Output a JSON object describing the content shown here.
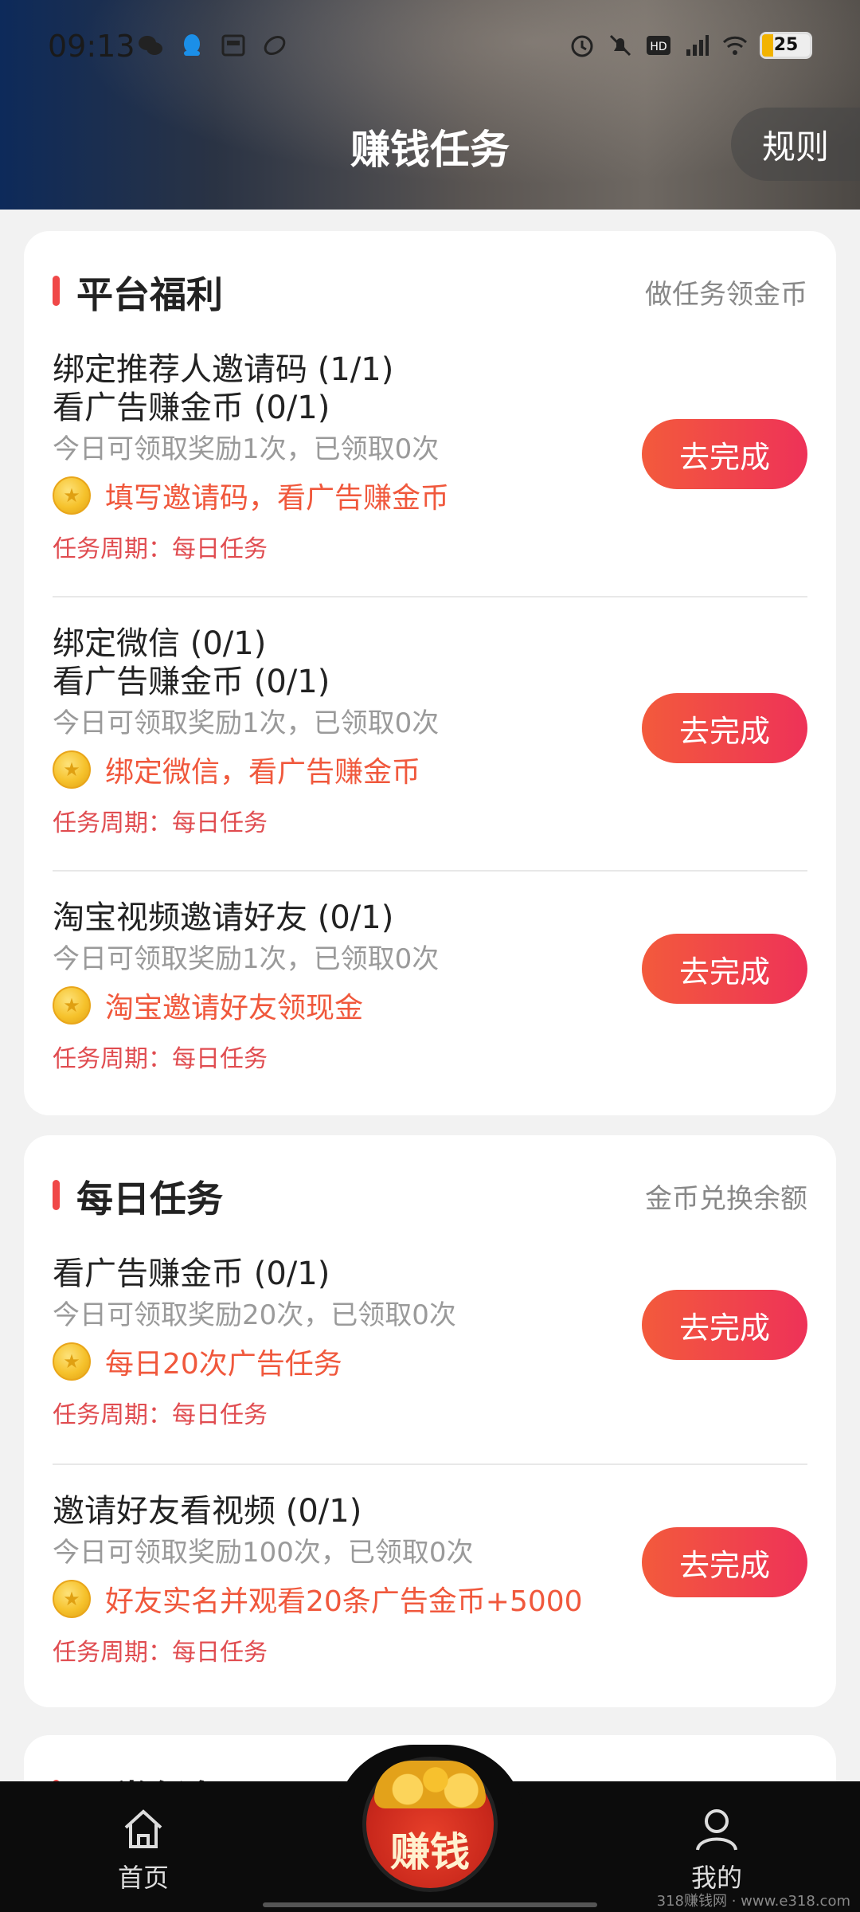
{
  "status_bar": {
    "time": "09:13",
    "battery": "25"
  },
  "header": {
    "title": "赚钱任务",
    "rules_label": "规则"
  },
  "sections": [
    {
      "title": "平台福利",
      "subtitle": "做任务领金币",
      "tasks": [
        {
          "title_line1": "绑定推荐人邀请码 (1/1)",
          "title_line2": "看广告赚金币 (0/1)",
          "sub": "今日可领取奖励1次，已领取0次",
          "desc": "填写邀请码，看广告赚金币",
          "cycle": "任务周期：每日任务",
          "button": "去完成"
        },
        {
          "title_line1": "绑定微信 (0/1)",
          "title_line2": "看广告赚金币 (0/1)",
          "sub": "今日可领取奖励1次，已领取0次",
          "desc": "绑定微信，看广告赚金币",
          "cycle": "任务周期：每日任务",
          "button": "去完成"
        },
        {
          "title_line1": "淘宝视频邀请好友 (0/1)",
          "sub": "今日可领取奖励1次，已领取0次",
          "desc": "淘宝邀请好友领现金",
          "cycle": "任务周期：每日任务",
          "button": "去完成"
        }
      ]
    },
    {
      "title": "每日任务",
      "subtitle": "金币兑换余额",
      "tasks": [
        {
          "title_line1": "看广告赚金币 (0/1)",
          "sub": "今日可领取奖励20次，已领取0次",
          "desc": "每日20次广告任务",
          "cycle": "任务周期：每日任务",
          "button": "去完成"
        },
        {
          "title_line1": "邀请好友看视频 (0/1)",
          "sub": "今日可领取奖励100次，已领取0次",
          "desc": "好友实名并观看20条广告金币+5000",
          "cycle": "任务周期：每日任务",
          "button": "去完成"
        }
      ]
    },
    {
      "title": "日常任务"
    }
  ],
  "bottom_nav": {
    "home": "首页",
    "earn": "赚钱",
    "mine": "我的"
  },
  "watermark": "318赚钱网 · www.e318.com",
  "colors": {
    "accent": "#f04848",
    "button_start": "#f35a3c",
    "button_end": "#ee3258",
    "desc": "#f0583c"
  }
}
